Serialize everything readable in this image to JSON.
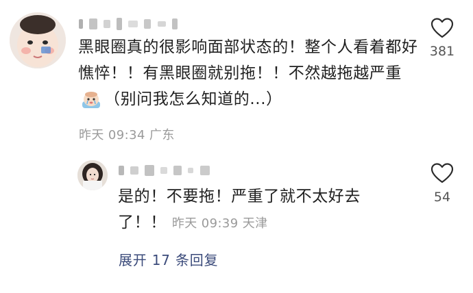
{
  "comments": [
    {
      "avatar_icon": "baby-avatar",
      "username_visible": "",
      "text_part1": "黑眼圈真的很影响面部状态的！整个人看着都好憔悴！！有黑眼圈就别拖！！不然越拖越严重",
      "sticker_icon": "crying-baby-sticker",
      "text_part2": "（别问我怎么知道的...）",
      "time": "昨天 09:34",
      "location": "广东",
      "like_icon": "heart-outline-icon",
      "like_count": "381"
    },
    {
      "avatar_icon": "girl-avatar",
      "username_visible": "",
      "text": "是的！不要拖！严重了就不太好去了！！",
      "time": "昨天 09:39",
      "location": "天津",
      "like_icon": "heart-outline-icon",
      "like_count": "54"
    }
  ],
  "expand_replies": "展开 17 条回复",
  "colors": {
    "text": "#1f1f1f",
    "meta": "#9a9a9a",
    "link": "#3a4a7a",
    "like": "#555555"
  }
}
